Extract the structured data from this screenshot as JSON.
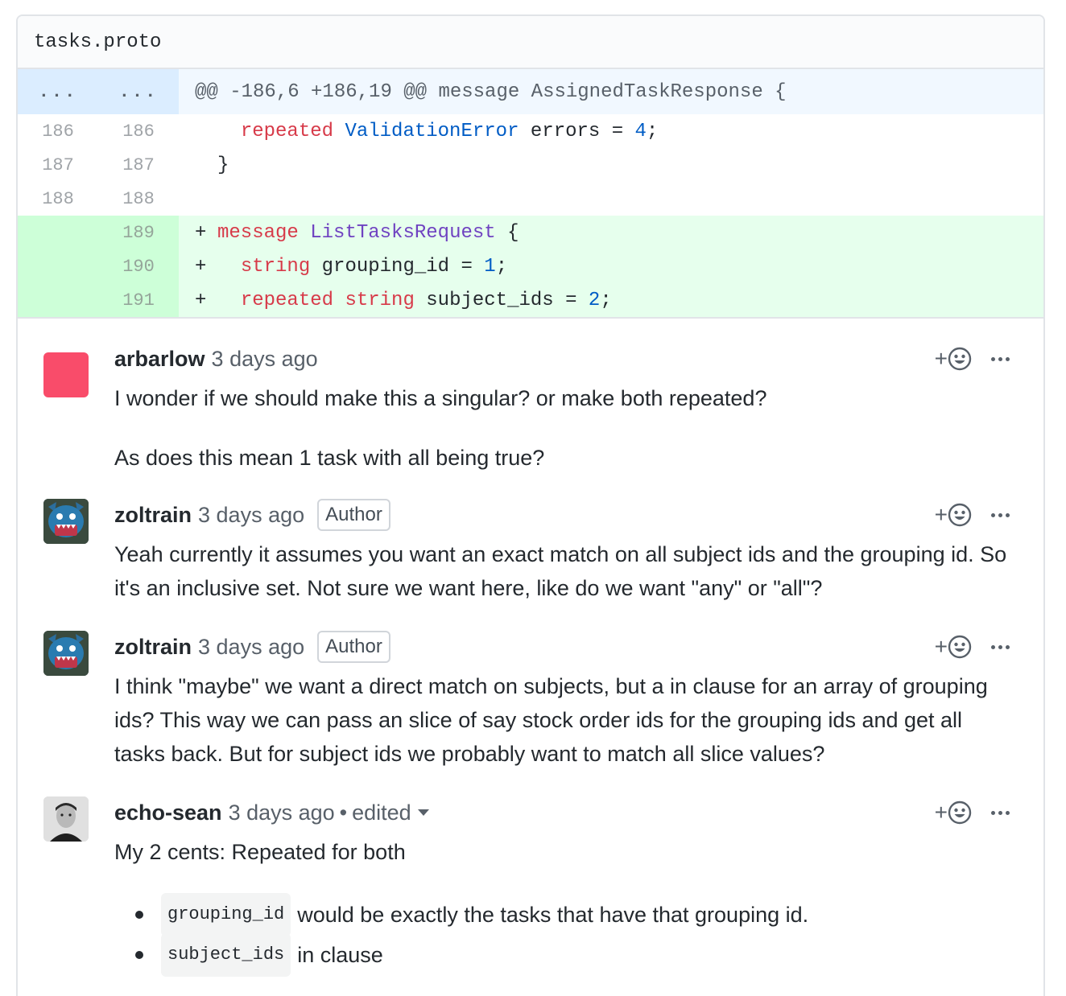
{
  "file": {
    "name": "tasks.proto"
  },
  "hunk": {
    "left": "...",
    "right": "...",
    "text": "@@ -186,6 +186,19 @@ message AssignedTaskResponse {"
  },
  "lines": [
    {
      "old": "186",
      "new": "186",
      "marker": "",
      "indent": "  ",
      "parts": [
        "repeated",
        "ValidationError",
        "errors = ",
        "4",
        ";"
      ]
    },
    {
      "old": "187",
      "new": "187",
      "marker": "",
      "indent": "",
      "text": "}"
    },
    {
      "old": "188",
      "new": "188",
      "marker": "",
      "text": ""
    },
    {
      "old": "",
      "new": "189",
      "marker": "+",
      "parts": [
        "message",
        "ListTasksRequest",
        "{"
      ]
    },
    {
      "old": "",
      "new": "190",
      "marker": "+",
      "parts": [
        "string",
        "grouping_id = ",
        "1",
        ";"
      ]
    },
    {
      "old": "",
      "new": "191",
      "marker": "+",
      "parts": [
        "repeated",
        "string",
        "subject_ids = ",
        "2",
        ";"
      ]
    }
  ],
  "comments": [
    {
      "author": "arbarlow",
      "time": "3 days ago",
      "paragraphs": [
        "I wonder if we should make this a singular? or make both repeated?",
        "As does this mean 1 task with all being true?"
      ]
    },
    {
      "author": "zoltrain",
      "time": "3 days ago",
      "badge": "Author",
      "paragraphs": [
        "Yeah currently it assumes you want an exact match on all subject ids and the grouping id. So it's an inclusive set. Not sure we want here, like do we want \"any\" or \"all\"?"
      ]
    },
    {
      "author": "zoltrain",
      "time": "3 days ago",
      "badge": "Author",
      "paragraphs": [
        "I think \"maybe\" we want a direct match on subjects, but a in clause for an array of grouping ids? This way we can pass an slice of say stock order ids for the grouping ids and get all tasks back. But for subject ids we probably want to match all slice values?"
      ]
    },
    {
      "author": "echo-sean",
      "time": "3 days ago",
      "separator": "•",
      "edited": "edited",
      "paragraphs": [
        "My 2 cents: Repeated for both"
      ],
      "bullets": [
        {
          "code": "grouping_id",
          "text": "would be exactly the tasks that have that grouping id."
        },
        {
          "code": "subject_ids",
          "text": "in clause"
        }
      ]
    }
  ],
  "actions": {
    "react_plus": "+",
    "react_icon": "smiley-icon",
    "more_icon": "kebab-icon"
  },
  "colors": {
    "added_bg": "#e6ffed",
    "hunk_bg": "#f1f8ff",
    "keyword": "#d73a49",
    "type": "#005cc5",
    "message_name": "#6f42c1"
  }
}
